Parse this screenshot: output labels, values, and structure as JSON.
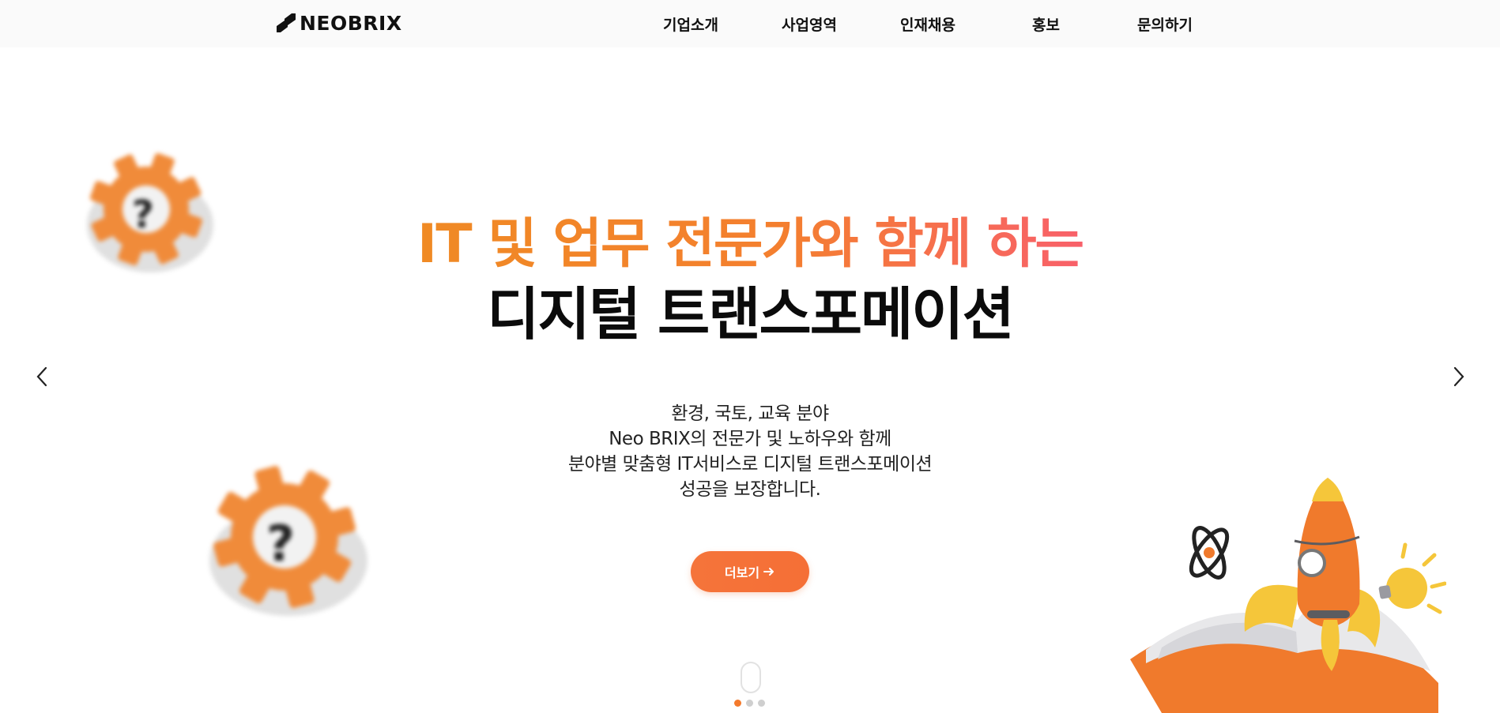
{
  "header": {
    "logo_text": "NEOBRIX",
    "nav": [
      "기업소개",
      "사업영역",
      "인재채용",
      "홍보",
      "문의하기"
    ]
  },
  "hero": {
    "title_line1": "IT 및 업무 전문가와 함께 하는",
    "title_line2": "디지털 트랜스포메이션",
    "description": [
      "환경, 국토, 교육 분야",
      "Neo BRIX의 전문가 및 노하우와 함께",
      "분야별 맞춤형 IT서비스로 디지털 트랜스포메이션",
      "성공을 보장합니다."
    ],
    "more_button": "더보기"
  },
  "slider": {
    "active_index": 0,
    "count": 3
  },
  "colors": {
    "accent": "#f47a2c",
    "gradient_end": "#f8606a",
    "text": "#0b0b0b"
  },
  "icons": {
    "prev": "chevron-left-icon",
    "next": "chevron-right-icon",
    "button_arrow": "arrow-right-icon",
    "scroll": "mouse-scroll-icon"
  }
}
